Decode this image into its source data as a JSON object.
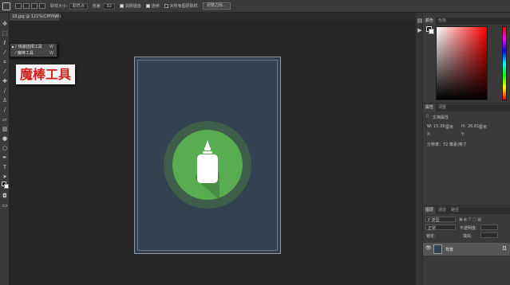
{
  "options_bar": {
    "sample_size_label": "取样大小:",
    "sample_size_value": "取样点",
    "tolerance_label": "容差:",
    "tolerance_value": "32",
    "anti_alias_label": "消除锯齿",
    "contiguous_label": "连续",
    "sample_all_layers_label": "对所有图层取样",
    "refine_edge_button": "调整边缘..."
  },
  "document_tab": {
    "title": "18.jpg @ 121%(CMYK/8)",
    "close_glyph": "×"
  },
  "tool_flyout": {
    "items": [
      {
        "label": "快速选择工具",
        "shortcut": "W"
      },
      {
        "label": "魔棒工具",
        "shortcut": "W"
      }
    ]
  },
  "callout": {
    "text": "魔棒工具"
  },
  "color_panel": {
    "tabs": [
      "颜色",
      "色板"
    ]
  },
  "properties_panel": {
    "tabs": [
      "属性",
      "调整"
    ],
    "doc_props_label": "文档属性",
    "width_label": "W:",
    "width_value": "15.39",
    "width_unit": "厘米",
    "height_label": "H:",
    "height_value": "26.61",
    "height_unit": "厘米",
    "x_label": "X:",
    "y_label": "Y:",
    "resolution_text": "分辨率：72 像素/英寸"
  },
  "layers_panel": {
    "tabs": [
      "图层",
      "通道",
      "路径"
    ],
    "kind_label": "P 类型",
    "mode_label": "正常",
    "opacity_label": "不透明度:",
    "lock_label": "锁定:",
    "fill_label": "填充:",
    "layer_name": "背景"
  },
  "colors": {
    "canvas_bg": "#334251",
    "logo_green": "#58ad50",
    "callout_text": "#d0201c"
  }
}
